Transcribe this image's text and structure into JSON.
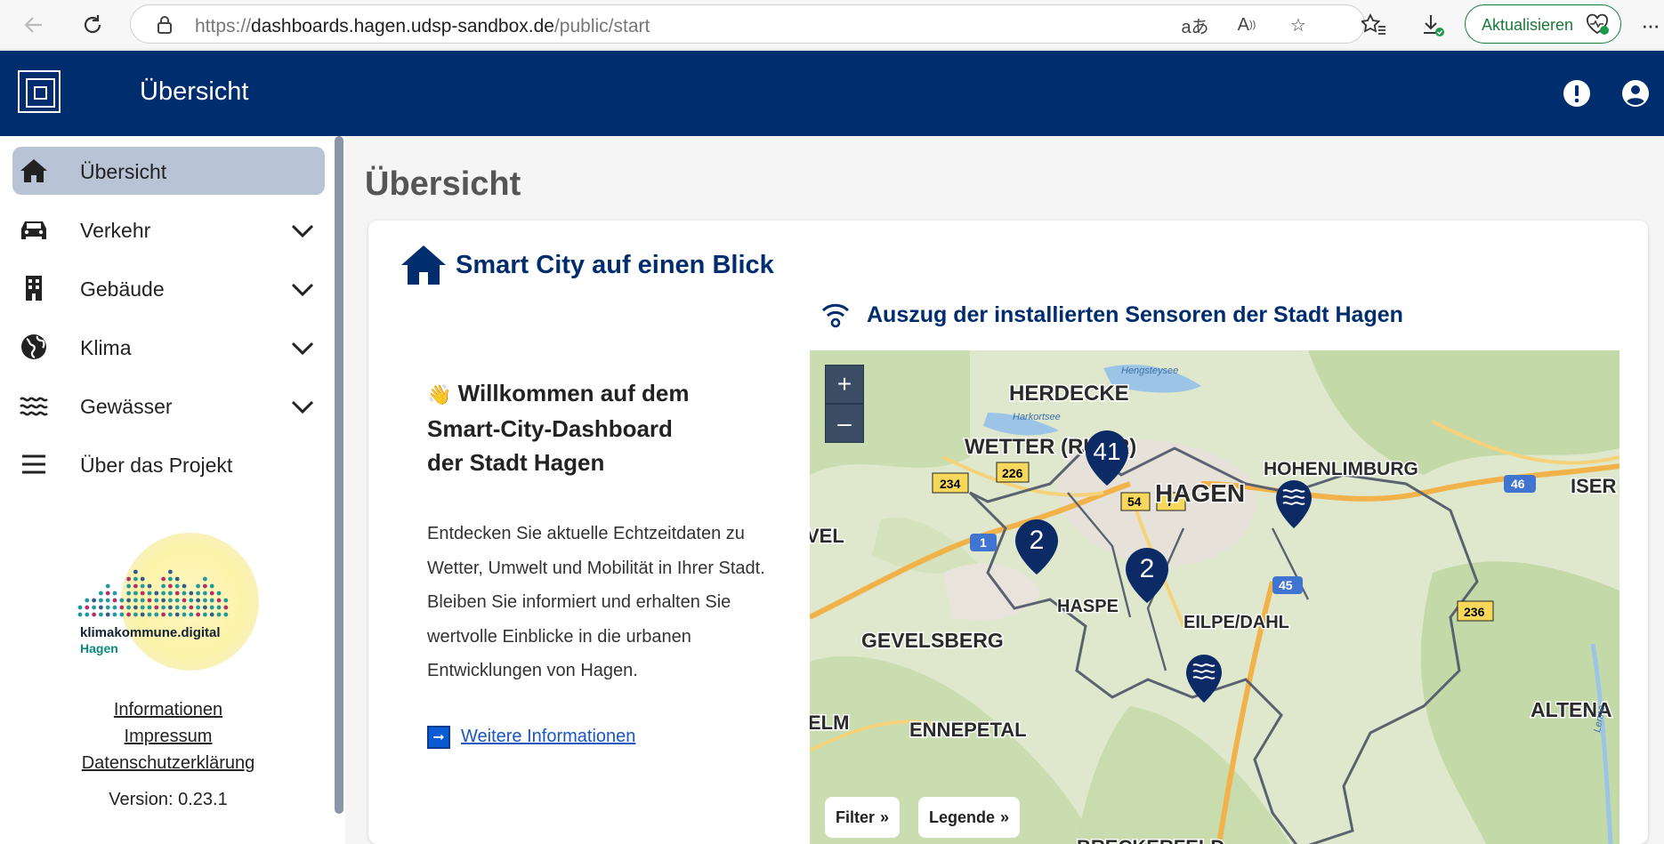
{
  "browser": {
    "url_prefix": "https://",
    "url_host": "dashboards.hagen.udsp-sandbox.de",
    "url_path": "/public/start",
    "update_label": "Aktualisieren"
  },
  "header": {
    "title": "Übersicht"
  },
  "sidebar": {
    "items": [
      {
        "label": "Übersicht",
        "icon": "home-icon"
      },
      {
        "label": "Verkehr",
        "icon": "car-icon"
      },
      {
        "label": "Gebäude",
        "icon": "building-icon"
      },
      {
        "label": "Klima",
        "icon": "globe-icon"
      },
      {
        "label": "Gewässer",
        "icon": "water-icon"
      },
      {
        "label": "Über das Projekt",
        "icon": "menu-icon"
      }
    ],
    "logo_text": "klimakommune.digital",
    "logo_sub": "Hagen",
    "links": [
      "Informationen",
      "Impressum",
      "Datenschutzerklärung"
    ],
    "version": "Version: 0.23.1"
  },
  "main": {
    "page_title": "Übersicht",
    "card_title": "Smart City auf einen Blick",
    "welcome_emoji": "👋",
    "welcome_line1": "Willkommen auf dem",
    "welcome_line2": "Smart-City-Dashboard",
    "welcome_line3": "der Stadt Hagen",
    "description": "Entdecken Sie aktuelle Echtzeitdaten zu Wetter, Umwelt und Mobilität in Ihrer Stadt. Bleiben Sie informiert und erhalten Sie wertvolle Einblicke in die urbanen Entwicklungen von Hagen.",
    "more_link": "Weitere Informationen",
    "sensor_title": "Auszug der installierten Sensoren der Stadt Hagen"
  },
  "map": {
    "zoom_in": "+",
    "zoom_out": "–",
    "filter_label": "Filter",
    "legend_label": "Legende",
    "places": [
      "HERDECKE",
      "WETTER (RUHR)",
      "HOHENLIMBURG",
      "HAGEN",
      "ISER",
      "VEL",
      "GEVELSBERG",
      "HASPE",
      "EILPE/DAHL",
      "ELM",
      "ENNEPETAL",
      "ALTENA",
      "BRECKERFELD",
      "Hengsteysee",
      "Harkortsee",
      "Lenne"
    ],
    "road_labels": [
      "234",
      "226",
      "54",
      "7",
      "1",
      "45",
      "46",
      "236"
    ],
    "clusters": [
      "41",
      "2",
      "2"
    ]
  },
  "colors": {
    "primary": "#002d6e",
    "active_bg": "#b8c3d6",
    "link": "#1a56c0",
    "update_green": "#1b7a3a"
  }
}
